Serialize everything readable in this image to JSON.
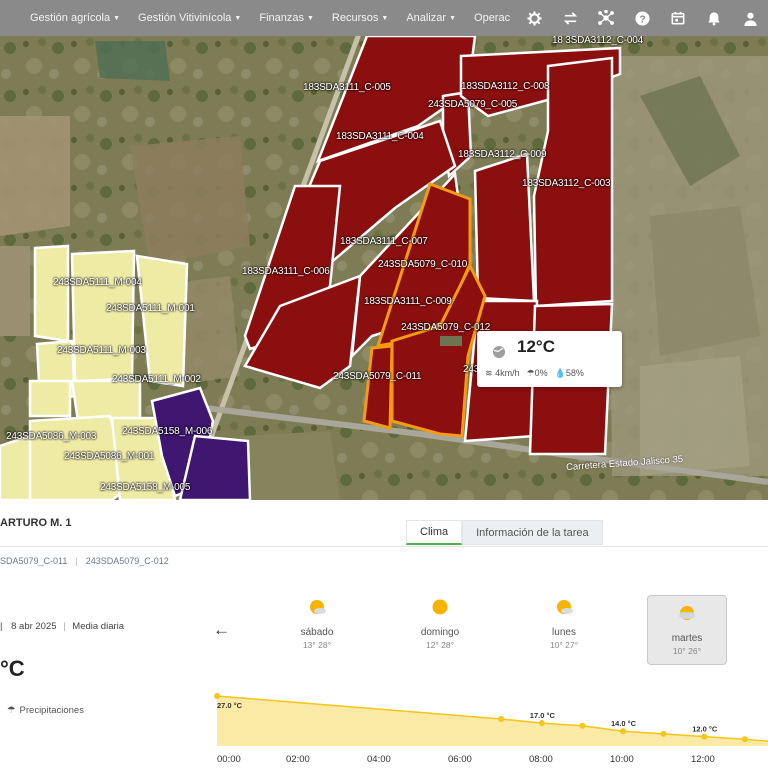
{
  "topbar": {
    "menus": [
      {
        "label": "Gestión agrícola"
      },
      {
        "label": "Gestión Vitivinícola"
      },
      {
        "label": "Finanzas"
      },
      {
        "label": "Recursos"
      },
      {
        "label": "Analizar"
      },
      {
        "label": "Operaciones de cam"
      }
    ],
    "icons": [
      "gear-icon",
      "swap-icon",
      "network-icon",
      "help-icon",
      "calendar-icon",
      "bell-icon",
      "user-icon"
    ]
  },
  "map": {
    "plot_labels": [
      "18 3SDA3112_C-004",
      "183SDA3111_C-005",
      "183SDA3112_C-008",
      "243SDA5079_C-005",
      "183SDA3111_C-004",
      "183SDA3112_C-009",
      "183SDA3112_C-003",
      "183SDA3111_C-007",
      "183SDA3111_C-006",
      "243SDA5079_C-010",
      "243SDA5111_M-004",
      "183SDA3111_C-009",
      "243SDA5111_M-001",
      "243SDA5079_C-012",
      "243SDA5111_M-003",
      "243SDA5079_C-011",
      "243SDA5111_M-002",
      "243SDA5086_M-003",
      "243SDA5158_M-006",
      "243SDA5086_M-001",
      "243SDA5158_M-005",
      "243"
    ],
    "road_label": "Carretera Estado Jalisco 35",
    "colors": {
      "vineyard": "#8b0f0f",
      "olive": "#eeeba5",
      "purple": "#3f1670",
      "selected_outline": "#f39c12"
    }
  },
  "popup": {
    "temp": "12°C",
    "wind": "4km/h",
    "rain": "0%",
    "humidity": "58%"
  },
  "panel": {
    "title": "ARTURO M. 1",
    "tabs": [
      {
        "label": "Clima",
        "active": true
      },
      {
        "label": "Información de la tarea",
        "active": false
      }
    ],
    "chips": [
      "SDA5079_C-011",
      "243SDA5079_C-012"
    ],
    "date_prefix": "|",
    "date": "8 abr 2025",
    "mode": "Media diaria",
    "current_temp": "°C",
    "precip_label": "Precipitaciones",
    "days": [
      {
        "name": "sábado",
        "temps": "13° 28°",
        "active": false
      },
      {
        "name": "domingo",
        "temps": "12° 28°",
        "active": false
      },
      {
        "name": "lunes",
        "temps": "10° 27°",
        "active": false
      },
      {
        "name": "martes",
        "temps": "10° 26°",
        "active": true
      }
    ]
  },
  "chart_data": {
    "type": "area",
    "x": [
      "00:00",
      "02:00",
      "04:00",
      "06:00",
      "08:00",
      "10:00",
      "12:00"
    ],
    "points": [
      {
        "x": "00:00",
        "y": 27.0,
        "label": "27.0 °C"
      },
      {
        "x": "07:00",
        "y": 18.5
      },
      {
        "x": "08:00",
        "y": 17.0,
        "label": "17.0 °C"
      },
      {
        "x": "09:00",
        "y": 16.0
      },
      {
        "x": "10:00",
        "y": 14.0,
        "label": "14.0 °C"
      },
      {
        "x": "11:00",
        "y": 13.0
      },
      {
        "x": "12:00",
        "y": 12.0,
        "label": "12.0 °C"
      },
      {
        "x": "13:00",
        "y": 11.0
      }
    ],
    "ylim": [
      0,
      30
    ],
    "color": "#f5c518"
  }
}
